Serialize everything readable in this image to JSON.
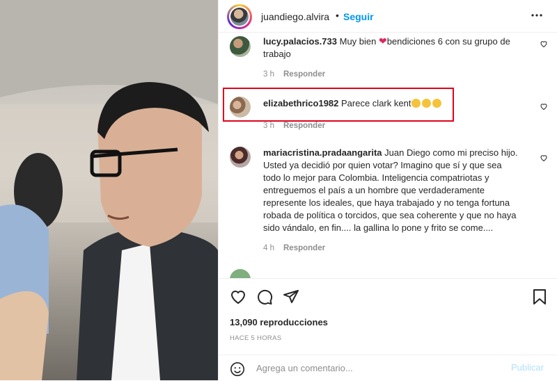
{
  "header": {
    "username": "juandiego.alvira",
    "separator": "•",
    "follow_label": "Seguir",
    "more_icon": "ellipsis-icon"
  },
  "comments": [
    {
      "username": "lucy.palacios.733",
      "text_before_emoji": " Muy bien ",
      "emoji": "heart-emoji",
      "text_after_emoji": "bendiciones 6 con su grupo de",
      "text_line2": "trabajo",
      "time": "3 h",
      "reply_label": "Responder"
    },
    {
      "username": "elizabethrico1982",
      "text": " Parece clark kent",
      "emoji": "grimacing-emoji x3",
      "time": "3 h",
      "reply_label": "Responder"
    },
    {
      "username": "mariacristina.pradaangarita",
      "lines": [
        " Juan Diego como mi preciso hijo.",
        "Usted ya decidió por quien votar? Imagino que sí y que sea",
        "todo lo mejor para Colombia. Inteligencia compatriotas y",
        "entreguemos el país a un hombre que verdaderamente",
        "represente los ideales, que haya trabajado y no tenga fortuna",
        "robada de política o torcidos, que sea coherente y que no haya",
        "sido vándalo, en fin.... la gallina lo pone y frito se come...."
      ],
      "time": "4 h",
      "reply_label": "Responder"
    }
  ],
  "actions": {
    "views": "13,090 reproducciones",
    "timestamp": "HACE 5 HORAS"
  },
  "add_comment": {
    "placeholder": "Agrega un comentario...",
    "publish_label": "Publicar"
  },
  "colors": {
    "accent": "#0095f6",
    "highlight": "#e0001b",
    "muted": "#8e8e8e",
    "text": "#262626"
  }
}
